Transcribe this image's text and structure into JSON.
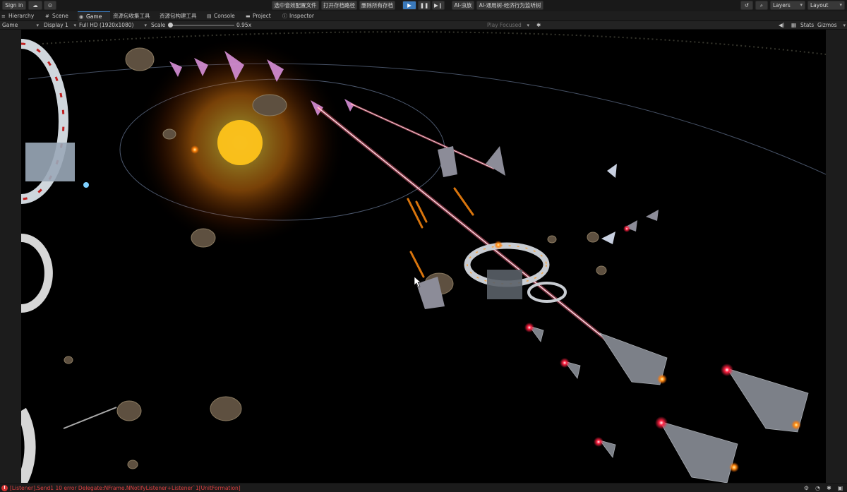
{
  "toolbar": {
    "sign_in": "Sign in",
    "btn_effects_config": "选中音效配置文件",
    "btn_open_save_path": "打开存档路径",
    "btn_delete_saves": "删除所有存档",
    "btn_ai_bug": "AI-虫族",
    "btn_ai_tree": "AI-通用树-经济行为监听树",
    "layers": "Layers",
    "layout": "Layout"
  },
  "tabs": [
    {
      "label": "Hierarchy",
      "icon": "≡"
    },
    {
      "label": "Scene",
      "icon": "#"
    },
    {
      "label": "Game",
      "icon": "◉"
    },
    {
      "label": "资源包收集工具",
      "icon": ""
    },
    {
      "label": "资源包构建工具",
      "icon": ""
    },
    {
      "label": "Console",
      "icon": "▤"
    },
    {
      "label": "Project",
      "icon": "▬"
    },
    {
      "label": "Inspector",
      "icon": "ⓘ"
    }
  ],
  "gamebar": {
    "view": "Game",
    "display": "Display 1",
    "resolution": "Full HD (1920x1080)",
    "scale_label": "Scale",
    "scale_value": "0.95x",
    "play_focused": "Play Focused",
    "stats": "Stats",
    "gizmos": "Gizmos"
  },
  "status": {
    "error_text": "[Listener].Send1 10 error Delegate:NFrame.NNotifyListener+Listener`1[UnitFormation]"
  },
  "colors": {
    "accent": "#3a79bb",
    "error": "#e04040",
    "laser": "#ff4d6d",
    "sun": "#ff9a1a"
  }
}
